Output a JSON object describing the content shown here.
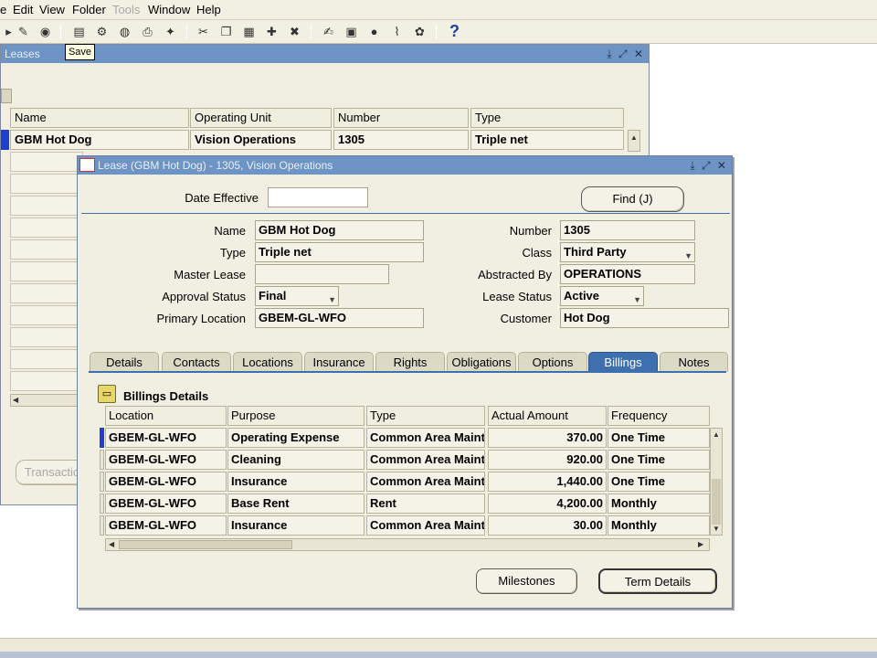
{
  "menu": [
    "e",
    "Edit",
    "View",
    "Folder",
    "Tools",
    "Window",
    "Help"
  ],
  "tooltip": "Save",
  "back_window": {
    "title": "Leases",
    "headers": [
      "Name",
      "Operating Unit",
      "Number",
      "Type"
    ],
    "row": [
      "GBM Hot Dog",
      "Vision Operations",
      "1305",
      "Triple net"
    ],
    "button": "Transactio"
  },
  "dialog": {
    "title": "Lease (GBM Hot Dog) - 1305, Vision Operations",
    "date_effective_label": "Date Effective",
    "date_effective_value": "",
    "find_button": "Find (J)",
    "left_fields": [
      {
        "label": "Name",
        "value": "GBM Hot Dog"
      },
      {
        "label": "Type",
        "value": "Triple net"
      },
      {
        "label": "Master Lease",
        "value": ""
      },
      {
        "label": "Approval Status",
        "value": "Final"
      },
      {
        "label": "Primary Location",
        "value": "GBEM-GL-WFO"
      }
    ],
    "right_fields": [
      {
        "label": "Number",
        "value": "1305"
      },
      {
        "label": "Class",
        "value": "Third Party"
      },
      {
        "label": "Abstracted By",
        "value": "OPERATIONS"
      },
      {
        "label": "Lease Status",
        "value": "Active"
      },
      {
        "label": "Customer",
        "value": "Hot Dog"
      }
    ],
    "tabs": [
      "Details",
      "Contacts",
      "Locations",
      "Insurance",
      "Rights",
      "Obligations",
      "Options",
      "Billings",
      "Notes"
    ],
    "active_tab": "Billings",
    "section_title": "Billings Details",
    "grid_headers": [
      "Location",
      "Purpose",
      "Type",
      "Actual Amount",
      "Frequency"
    ],
    "grid_rows": [
      [
        "GBEM-GL-WFO",
        "Operating Expense",
        "Common Area Maint",
        "370.00",
        "One Time"
      ],
      [
        "GBEM-GL-WFO",
        "Cleaning",
        "Common Area Maint",
        "920.00",
        "One Time"
      ],
      [
        "GBEM-GL-WFO",
        "Insurance",
        "Common Area Maint",
        "1,440.00",
        "One Time"
      ],
      [
        "GBEM-GL-WFO",
        "Base Rent",
        "Rent",
        "4,200.00",
        "Monthly"
      ],
      [
        "GBEM-GL-WFO",
        "Insurance",
        "Common Area Maint",
        "30.00",
        "Monthly"
      ]
    ],
    "milestones_button": "Milestones",
    "term_details_button": "Term Details"
  }
}
